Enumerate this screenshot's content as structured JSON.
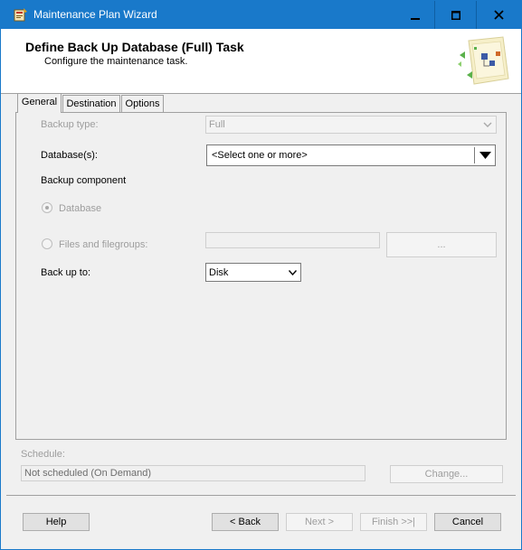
{
  "window": {
    "title": "Maintenance Plan Wizard",
    "colors": {
      "titlebar": "#1979ca",
      "titletext": "#ffffff",
      "header_bg": "#ffffff",
      "body_bg": "#f0f0f0"
    }
  },
  "caption_buttons": {
    "minimize_icon": "minimize-icon",
    "maximize_icon": "maximize-icon",
    "close_icon": "close-icon"
  },
  "header": {
    "title": "Define Back Up Database (Full) Task",
    "subtitle": "Configure the maintenance task."
  },
  "tabs": [
    {
      "label": "General",
      "selected": true
    },
    {
      "label": "Destination",
      "selected": false
    },
    {
      "label": "Options",
      "selected": false
    }
  ],
  "general": {
    "backup_type_label": "Backup type:",
    "backup_type_value": "Full",
    "databases_label": "Database(s):",
    "databases_value": "<Select one or more>",
    "backup_component_label": "Backup component",
    "component_database_label": "Database",
    "component_files_label": "Files and filegroups:",
    "files_value": "",
    "browse_button_label": "...",
    "back_up_to_label": "Back up to:",
    "back_up_to_value": "Disk"
  },
  "schedule": {
    "label": "Schedule:",
    "value": "Not scheduled (On Demand)",
    "change_button_label": "Change..."
  },
  "footer": {
    "help_label": "Help",
    "back_label": "< Back",
    "next_label": "Next >",
    "finish_label": "Finish >>|",
    "cancel_label": "Cancel"
  }
}
